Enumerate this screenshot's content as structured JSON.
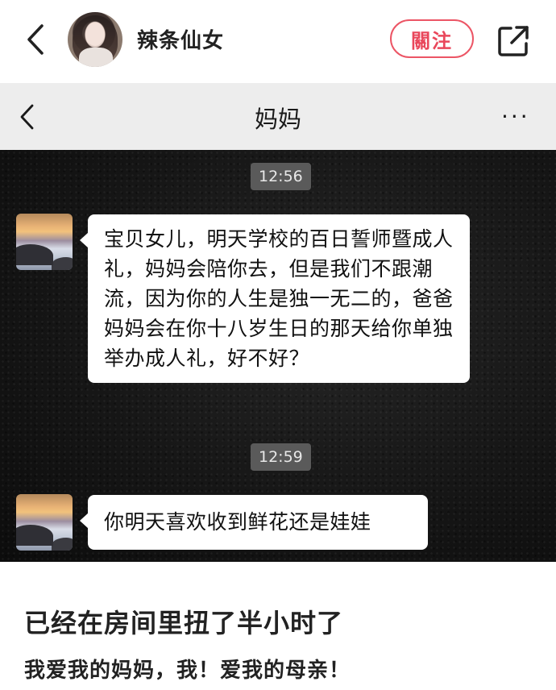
{
  "post_header": {
    "author_name": "辣条仙女",
    "follow_label": "關注",
    "icons": {
      "back": "chevron-left-icon",
      "share": "share-external-icon"
    }
  },
  "chat": {
    "title": "妈妈",
    "more_label": "···",
    "icons": {
      "back": "chevron-left-icon",
      "more": "more-dots-icon"
    },
    "messages": [
      {
        "time": "12:56",
        "text": "宝贝女儿，明天学校的百日誓师暨成人礼，妈妈会陪你去，但是我们不跟潮流，因为你的人生是独一无二的，爸爸妈妈会在你十八岁生日的那天给你单独举办成人礼，好不好？"
      },
      {
        "time": "12:59",
        "text": "你明天喜欢收到鲜花还是娃娃"
      }
    ]
  },
  "post": {
    "title": "已经在房间里扭了半小时了",
    "body": "我爱我的妈妈，我！爱我的母亲！"
  },
  "colors": {
    "follow_accent": "#e9475b",
    "chat_nav_bg": "#ededed",
    "chat_bg": "#161616",
    "time_chip_bg": "#5a5a5a",
    "bubble_bg": "#ffffff"
  }
}
